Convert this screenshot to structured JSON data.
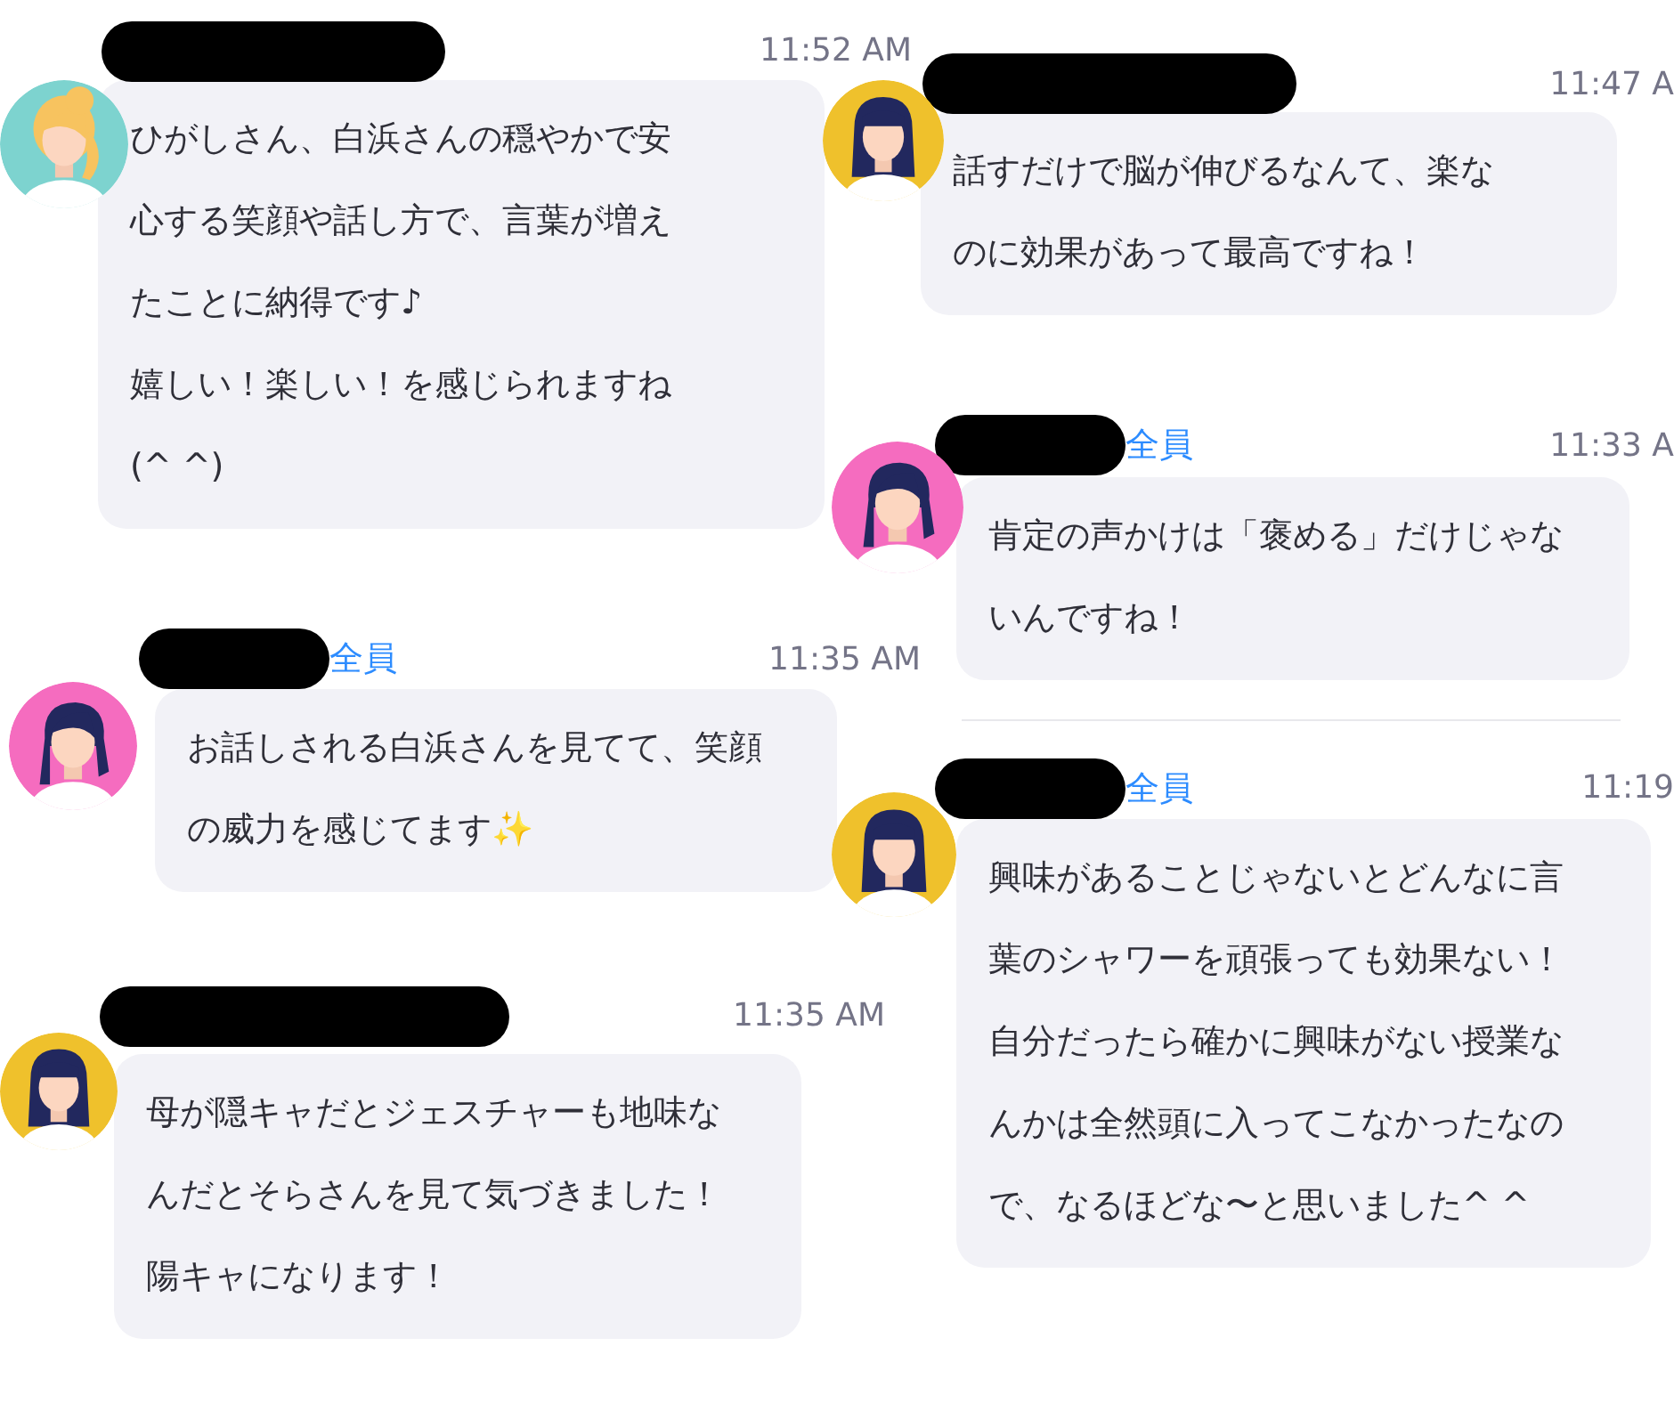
{
  "messages": [
    {
      "sender_redacted": true,
      "time": "11:52 AM",
      "avatar": {
        "kind": "bun",
        "color": "#7dd3cf"
      },
      "paragraphs": [
        "ひがしさん、白浜さんの穏やかで安心する笑顔や話し方で、言葉が増えたことに納得です♪",
        "嬉しい！楽しい！を感じられますね(^ ^)"
      ]
    },
    {
      "sender_redacted": true,
      "time": "11:47 A",
      "avatar": {
        "kind": "straight",
        "color": "#efc12c"
      },
      "paragraphs": [
        "話すだけで脳が伸びるなんて、楽なのに効果があって最高ですね！"
      ]
    },
    {
      "sender_redacted": true,
      "recipient": "全員",
      "time": "11:33 A",
      "avatar": {
        "kind": "side",
        "color": "#f56cbf"
      },
      "paragraphs": [
        "肯定の声かけは「褒める」だけじゃないんですね！"
      ]
    },
    {
      "sender_redacted": true,
      "recipient": "全員",
      "time": "11:35 AM",
      "avatar": {
        "kind": "side",
        "color": "#f56cbf"
      },
      "paragraphs": [
        "お話しされる白浜さんを見てて、笑顔の威力を感じてます✨"
      ]
    },
    {
      "sender_redacted": true,
      "recipient": "全員",
      "time": "11:19",
      "avatar": {
        "kind": "straight",
        "color": "#efc12c"
      },
      "paragraphs": [
        "興味があることじゃないとどんなに言葉のシャワーを頑張っても効果ない！",
        "自分だったら確かに興味がない授業なんかは全然頭に入ってこなかったなので、なるほどな〜と思いました^ ^"
      ]
    },
    {
      "sender_redacted": true,
      "time": "11:35 AM",
      "avatar": {
        "kind": "straight",
        "color": "#efc12c"
      },
      "paragraphs": [
        "母が隠キャだとジェスチャーも地味なんだとそらさんを見て気づきました！",
        "陽キャになります！"
      ]
    }
  ]
}
